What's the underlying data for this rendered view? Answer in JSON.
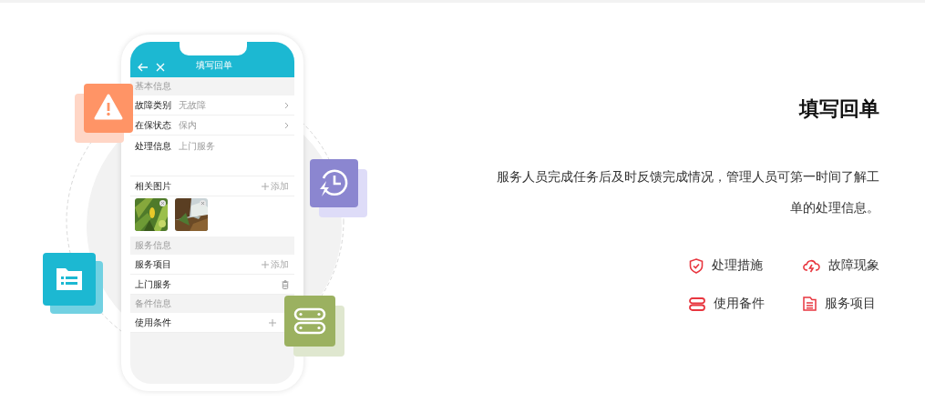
{
  "phone": {
    "title": "填写回单",
    "sections": [
      {
        "header": "基本信息",
        "rows": [
          {
            "kind": "select",
            "label": "故障类别",
            "value": "无故障"
          },
          {
            "kind": "select",
            "label": "在保状态",
            "value": "保内"
          },
          {
            "kind": "textarea",
            "label": "处理信息",
            "value": "上门服务"
          },
          {
            "kind": "add",
            "label": "相关图片",
            "action": "添加"
          },
          {
            "kind": "photos"
          }
        ]
      },
      {
        "header": "服务信息",
        "rows": [
          {
            "kind": "add",
            "label": "服务项目",
            "action": "添加"
          },
          {
            "kind": "delete",
            "label": "上门服务"
          }
        ]
      },
      {
        "header": "备件信息",
        "rows": [
          {
            "kind": "add",
            "label": "使用条件"
          }
        ]
      }
    ]
  },
  "title": "填写回单",
  "description": "服务人员完成任务后及时反馈完成情况，管理人员可第一时间了解工单的处理信息。",
  "features": [
    {
      "label": "处理措施"
    },
    {
      "label": "故障现象"
    },
    {
      "label": "使用备件"
    },
    {
      "label": "服务项目"
    }
  ]
}
